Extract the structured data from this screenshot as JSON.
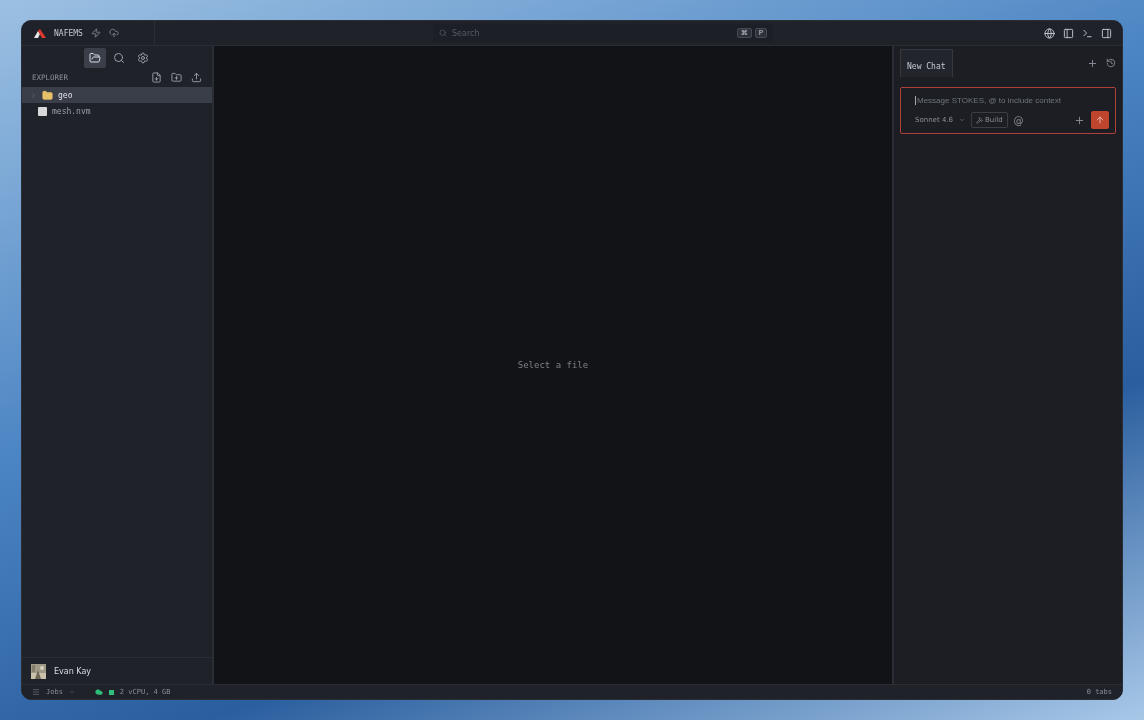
{
  "titlebar": {
    "app_name": "NAFEMS",
    "search": {
      "placeholder": "Search",
      "keys": [
        "⌘",
        "P"
      ]
    }
  },
  "sidebar": {
    "tools": [
      {
        "selected": true
      },
      {
        "selected": false
      },
      {
        "selected": false
      }
    ],
    "explorer": {
      "title": "EXPLORER",
      "items": [
        {
          "kind": "folder",
          "label": "geo",
          "selected": true
        },
        {
          "kind": "file",
          "label": "mesh.nvm",
          "selected": false
        }
      ]
    },
    "user": {
      "name": "Evan Kay"
    }
  },
  "editor": {
    "empty_text": "Select a file"
  },
  "chat": {
    "tabs": [
      {
        "label": "New Chat",
        "selected": true
      }
    ],
    "input": {
      "placeholder": "Message STOKES, @ to include context"
    },
    "model": "Sonnet 4.6",
    "mode": "Build",
    "at": "@"
  },
  "status_bar": {
    "jobs": "Jobs",
    "machine": "2 vCPU, 4 GB",
    "tabs": "0 tabs"
  }
}
